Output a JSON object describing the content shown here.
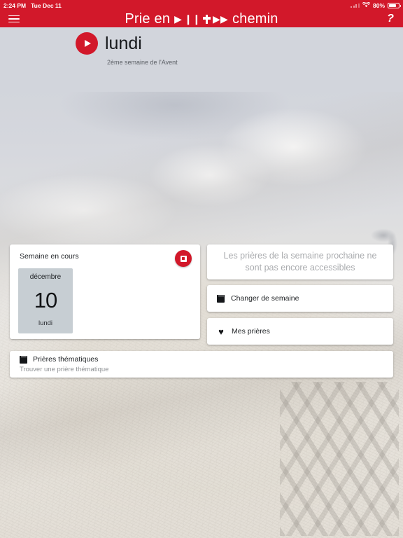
{
  "status_bar": {
    "time": "2:24 PM",
    "date": "Tue Dec 11",
    "battery_percent": "80%",
    "wifi_icon": "wifi-icon",
    "battery_icon": "battery-icon",
    "signal_icon": "cellular-signal-icon"
  },
  "navbar": {
    "menu_icon": "hamburger-menu-icon",
    "brand_prefix": "Prie en",
    "brand_suffix": "chemin",
    "brand_glyphs": {
      "play": "▶",
      "pause": "❙❙",
      "cross": "cross-icon",
      "fast_forward": "▶▶"
    },
    "help_icon": "help-question-icon",
    "help_glyph": "?",
    "background_color": "#d2182a"
  },
  "page_header": {
    "play_button_icon": "play-circle-icon",
    "day_title": "lundi",
    "subtitle": "2ème semaine de l'Avent"
  },
  "week_card": {
    "heading": "Semaine en cours",
    "stop_button_icon": "stop-square-icon",
    "date": {
      "month": "décembre",
      "day_number": "10",
      "weekday": "lundi"
    }
  },
  "notice_card": {
    "text": "Les prières de la semaine prochaine ne sont pas encore accessibles"
  },
  "actions": [
    {
      "label": "Changer de semaine",
      "icon": "calendar-icon"
    },
    {
      "label": "Mes prières",
      "icon": "heart-icon",
      "glyph": "♥"
    }
  ],
  "thematic_card": {
    "icon": "calendar-icon",
    "title": "Prières thématiques",
    "subtitle": "Trouver une prière thématique"
  },
  "colors": {
    "brand_red": "#d2182a",
    "card_white": "#ffffff",
    "datebox_gray": "#c7ced3",
    "top_background": "#d2d5dc",
    "muted_text": "#a9abae"
  }
}
